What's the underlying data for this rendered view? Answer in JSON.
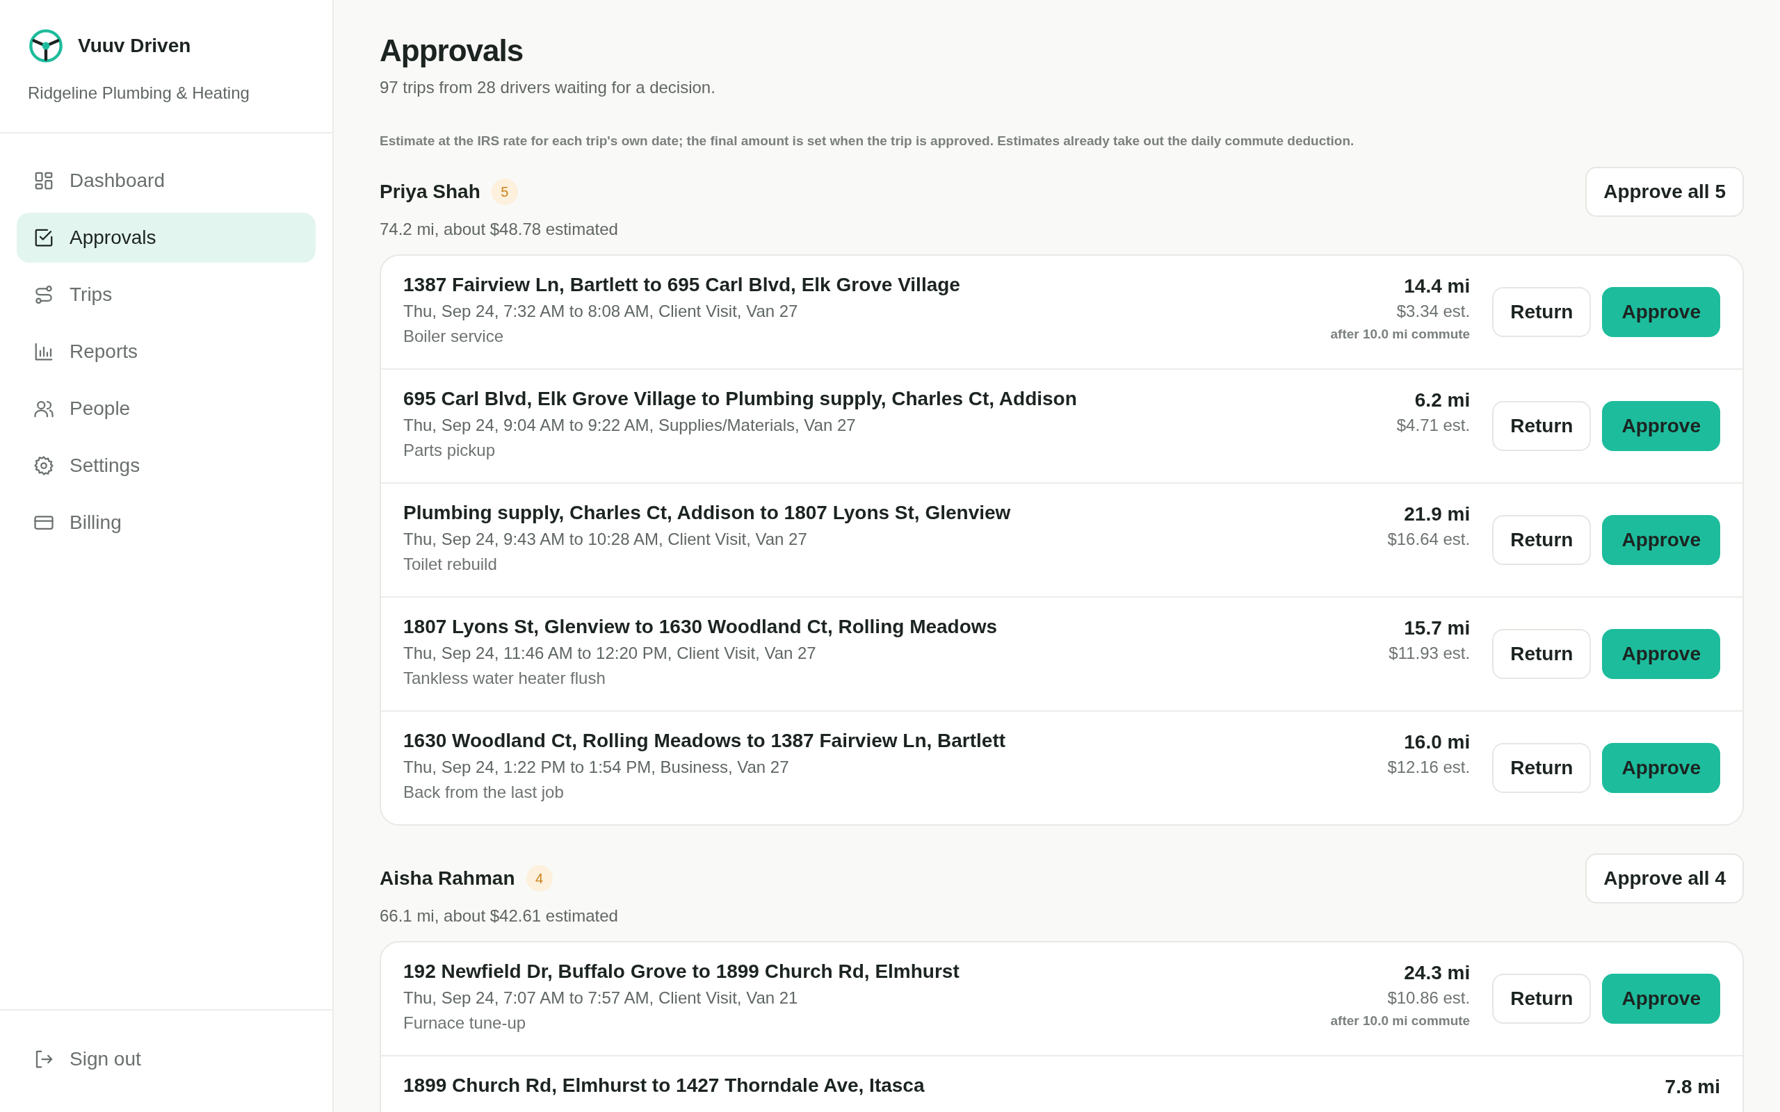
{
  "brand": {
    "name": "Vuuv Driven",
    "company": "Ridgeline Plumbing & Heating"
  },
  "nav": [
    {
      "label": "Dashboard",
      "kind": "grid",
      "selected": false
    },
    {
      "label": "Approvals",
      "kind": "check",
      "selected": true
    },
    {
      "label": "Trips",
      "kind": "route",
      "selected": false
    },
    {
      "label": "Reports",
      "kind": "chart",
      "selected": false
    },
    {
      "label": "People",
      "kind": "people",
      "selected": false
    },
    {
      "label": "Settings",
      "kind": "gear",
      "selected": false
    },
    {
      "label": "Billing",
      "kind": "card",
      "selected": false
    }
  ],
  "sign_out": "Sign out",
  "page": {
    "title": "Approvals",
    "subtitle": "97 trips from 28 drivers waiting for a decision.",
    "note": "Estimate at the IRS rate for each trip's own date; the final amount is set when the trip is approved. Estimates already take out the daily commute deduction."
  },
  "groups": [
    {
      "driver": "Priya Shah",
      "count": "5",
      "approve_all": "Approve all 5",
      "summary": "74.2 mi, about $48.78 estimated",
      "trips": [
        {
          "route": "1387 Fairview Ln, Bartlett to 695 Carl Blvd, Elk Grove Village",
          "details": "Thu, Sep 24, 7:32 AM to 8:08 AM, Client Visit, Van 27",
          "note": "Boiler service",
          "miles": "14.4 mi",
          "estimate": "$3.34 est.",
          "commute": "after 10.0 mi commute",
          "actions": [
            "Return",
            "Approve"
          ]
        },
        {
          "route": "695 Carl Blvd, Elk Grove Village to Plumbing supply, Charles Ct, Addison",
          "details": "Thu, Sep 24, 9:04 AM to 9:22 AM, Supplies/Materials, Van 27",
          "note": "Parts pickup",
          "miles": "6.2 mi",
          "estimate": "$4.71 est.",
          "actions": [
            "Return",
            "Approve"
          ]
        },
        {
          "route": "Plumbing supply, Charles Ct, Addison to 1807 Lyons St, Glenview",
          "details": "Thu, Sep 24, 9:43 AM to 10:28 AM, Client Visit, Van 27",
          "note": "Toilet rebuild",
          "miles": "21.9 mi",
          "estimate": "$16.64 est.",
          "actions": [
            "Return",
            "Approve"
          ]
        },
        {
          "route": "1807 Lyons St, Glenview to 1630 Woodland Ct, Rolling Meadows",
          "details": "Thu, Sep 24, 11:46 AM to 12:20 PM, Client Visit, Van 27",
          "note": "Tankless water heater flush",
          "miles": "15.7 mi",
          "estimate": "$11.93 est.",
          "actions": [
            "Return",
            "Approve"
          ]
        },
        {
          "route": "1630 Woodland Ct, Rolling Meadows to 1387 Fairview Ln, Bartlett",
          "details": "Thu, Sep 24, 1:22 PM to 1:54 PM, Business, Van 27",
          "note": "Back from the last job",
          "miles": "16.0 mi",
          "estimate": "$12.16 est.",
          "actions": [
            "Return",
            "Approve"
          ]
        }
      ]
    },
    {
      "driver": "Aisha Rahman",
      "count": "4",
      "approve_all": "Approve all 4",
      "summary": "66.1 mi, about $42.61 estimated",
      "trips": [
        {
          "route": "192 Newfield Dr, Buffalo Grove to 1899 Church Rd, Elmhurst",
          "details": "Thu, Sep 24, 7:07 AM to 7:57 AM, Client Visit, Van 21",
          "note": "Furnace tune-up",
          "miles": "24.3 mi",
          "estimate": "$10.86 est.",
          "commute": "after 10.0 mi commute",
          "actions": [
            "Return",
            "Approve"
          ]
        },
        {
          "route": "1899 Church Rd, Elmhurst to 1427 Thorndale Ave, Itasca",
          "miles": "7.8 mi"
        }
      ]
    }
  ]
}
